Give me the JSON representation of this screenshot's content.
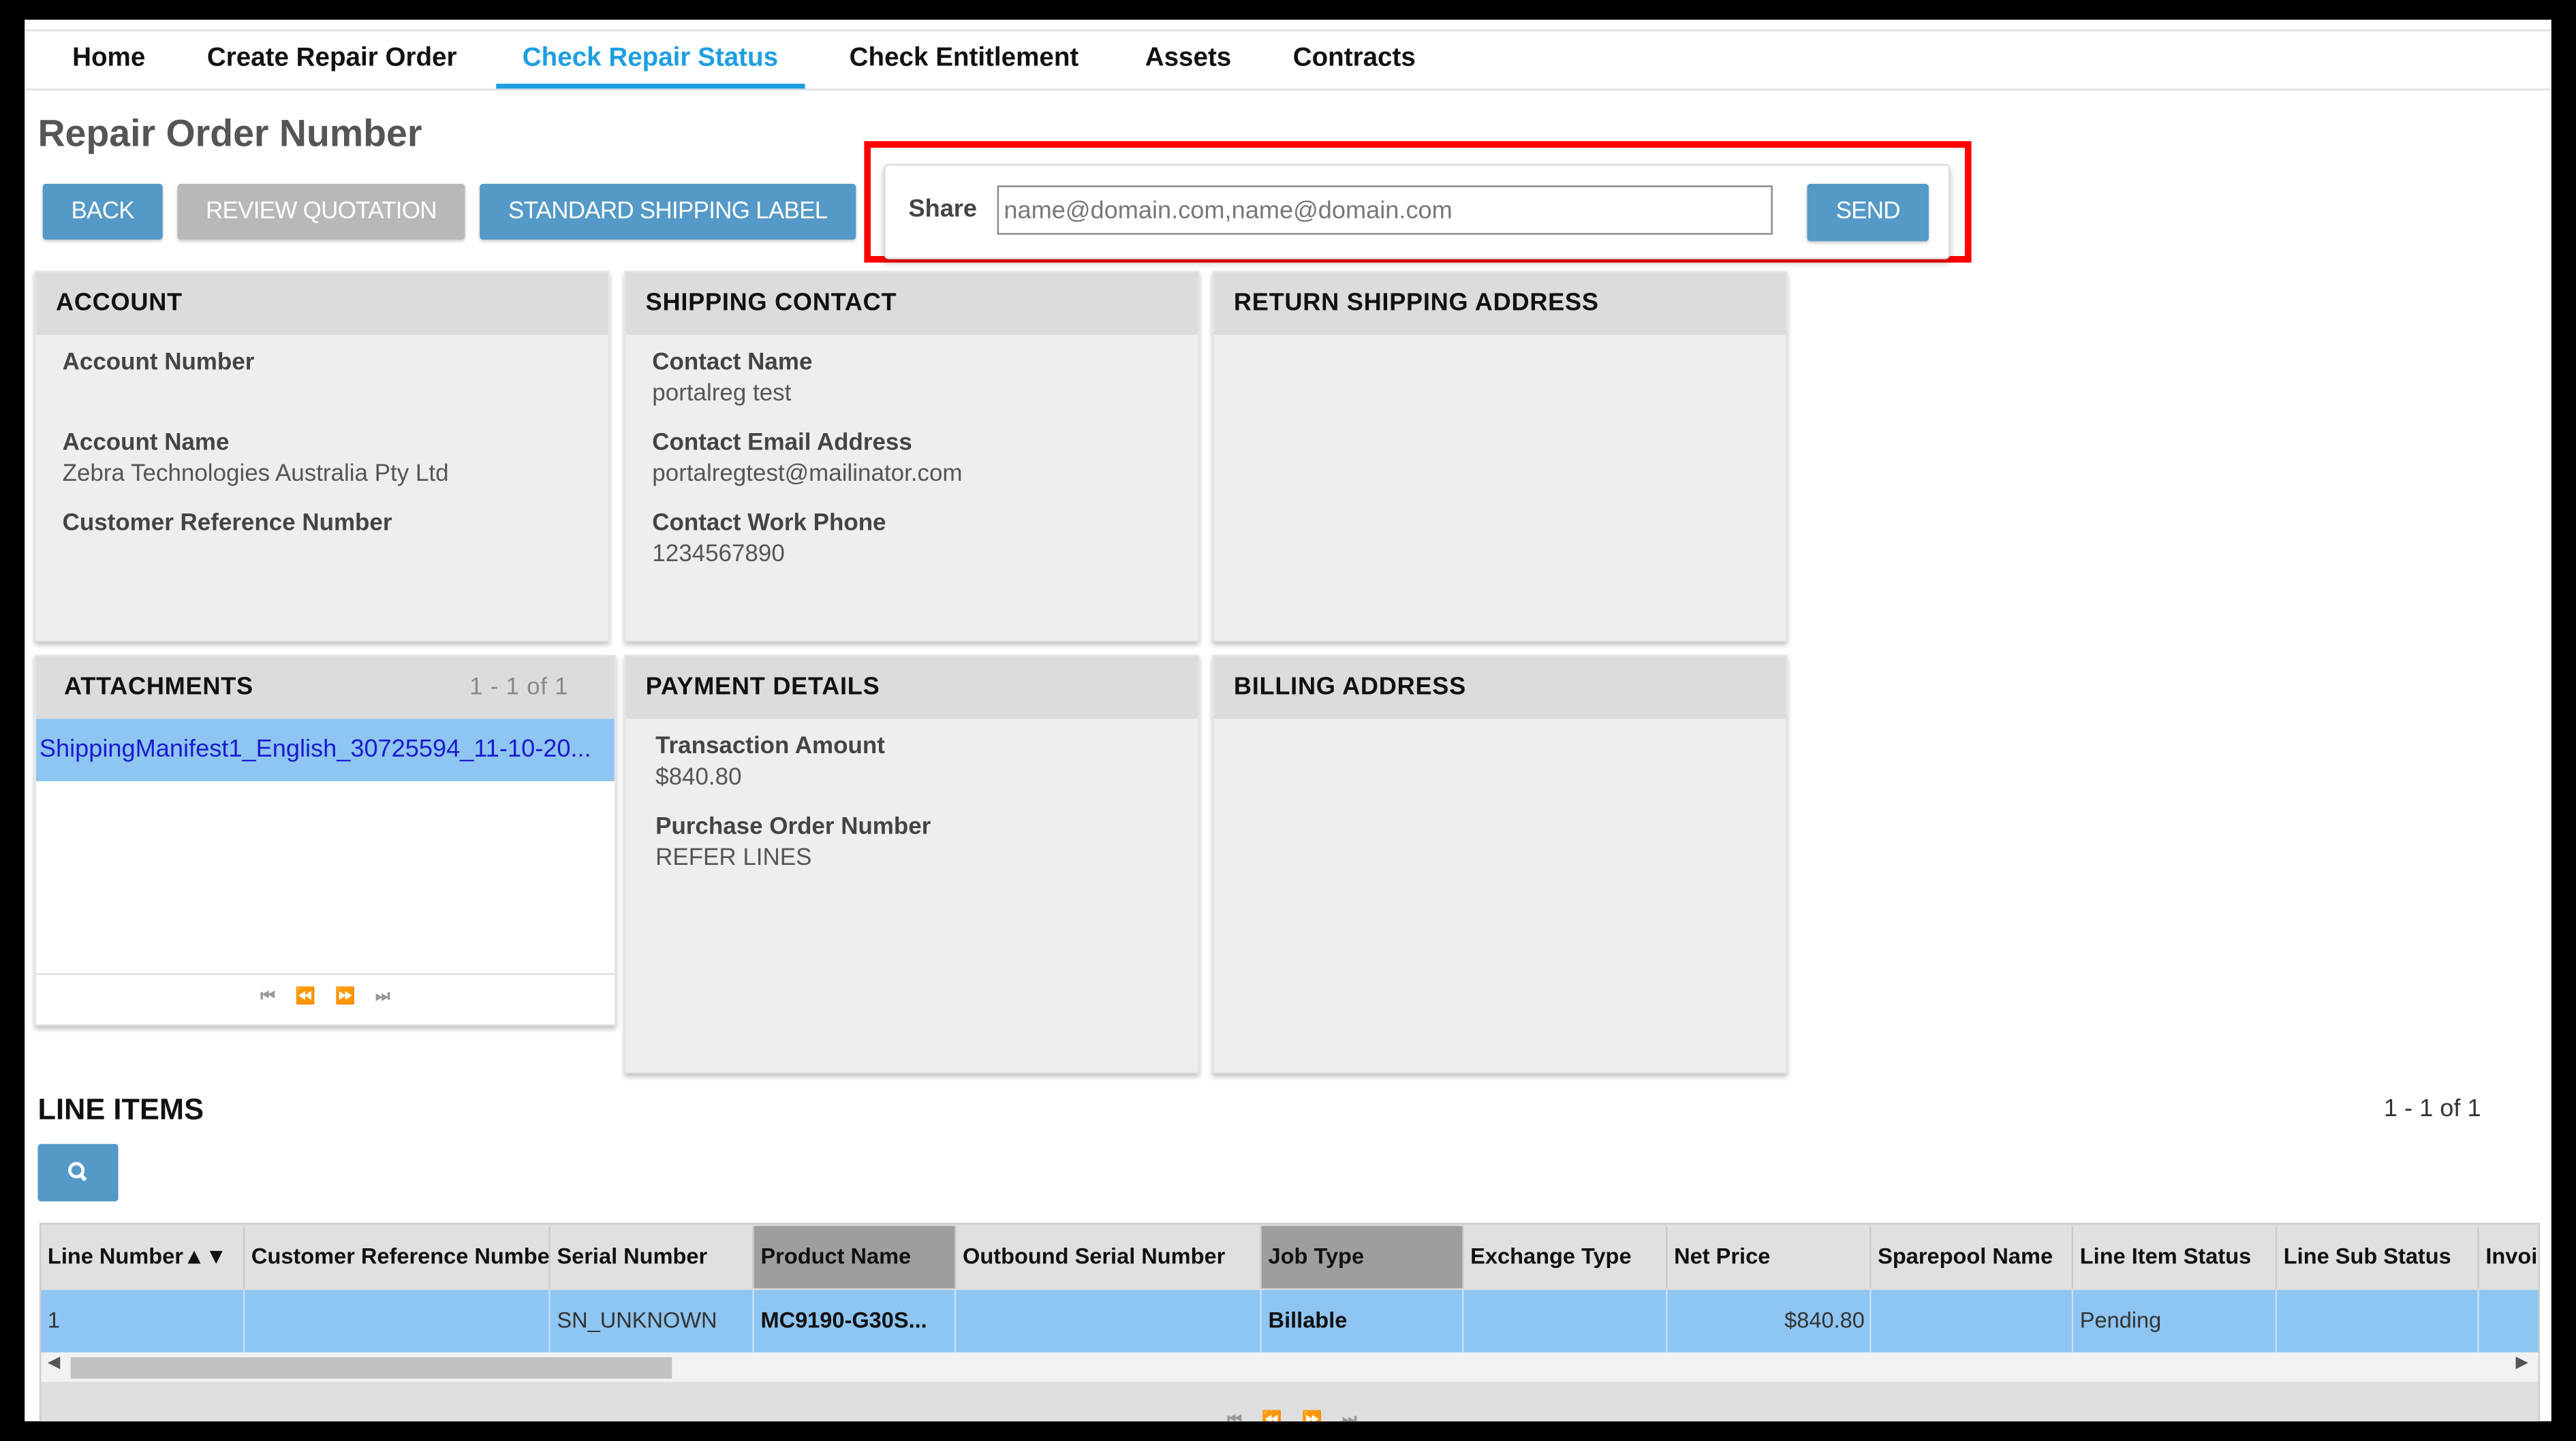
{
  "nav": {
    "items": [
      {
        "label": "Home"
      },
      {
        "label": "Create Repair Order"
      },
      {
        "label": "Check Repair Status",
        "active": true
      },
      {
        "label": "Check Entitlement"
      },
      {
        "label": "Assets"
      },
      {
        "label": "Contracts"
      }
    ]
  },
  "page": {
    "title": "Repair Order Number"
  },
  "toolbar": {
    "back_label": "BACK",
    "review_quotation_label": "REVIEW QUOTATION",
    "shipping_label_label": "STANDARD SHIPPING LABEL"
  },
  "share": {
    "label": "Share",
    "placeholder": "name@domain.com,name@domain.com",
    "value": "",
    "send_label": "SEND"
  },
  "account": {
    "title": "ACCOUNT",
    "fields": [
      {
        "label": "Account Number",
        "value": ""
      },
      {
        "label": "Account Name",
        "value": "Zebra Technologies Australia Pty Ltd"
      },
      {
        "label": "Customer Reference Number",
        "value": ""
      }
    ]
  },
  "shipping_contact": {
    "title": "SHIPPING CONTACT",
    "fields": [
      {
        "label": "Contact Name",
        "value": "portalreg test"
      },
      {
        "label": "Contact Email Address",
        "value": "portalregtest@mailinator.com"
      },
      {
        "label": "Contact Work Phone",
        "value": "1234567890"
      }
    ]
  },
  "return_shipping_address": {
    "title": "RETURN SHIPPING ADDRESS"
  },
  "attachments": {
    "title": "ATTACHMENTS",
    "count": "1 - 1 of 1",
    "items": [
      {
        "name": "ShippingManifest1_English_30725594_11-10-20..."
      }
    ]
  },
  "payment_details": {
    "title": "PAYMENT DETAILS",
    "fields": [
      {
        "label": "Transaction Amount",
        "value": "$840.80"
      },
      {
        "label": "Purchase Order Number",
        "value": "REFER LINES"
      }
    ]
  },
  "billing_address": {
    "title": "BILLING ADDRESS"
  },
  "line_items": {
    "title": "LINE ITEMS",
    "count": "1 - 1 of 1",
    "sort_indicator": "▲▼",
    "columns": [
      "Line Number",
      "Customer Reference Number",
      "Serial Number",
      "Product Name",
      "Outbound Serial Number",
      "Job Type",
      "Exchange Type",
      "Net Price",
      "Sparepool Name",
      "Line Item Status",
      "Line Sub Status",
      "Invoi"
    ],
    "rows": [
      [
        "1",
        "",
        "SN_UNKNOWN",
        "MC9190-G30S...",
        "",
        "Billable",
        "",
        "$840.80",
        "",
        "Pending",
        "",
        ""
      ]
    ]
  },
  "colors": {
    "accent": "#1e9ee0",
    "button": "#5499c7",
    "button_disabled": "#b8b8b8",
    "selected_row": "#8ec5f2",
    "highlight_box": "#ff0000"
  }
}
